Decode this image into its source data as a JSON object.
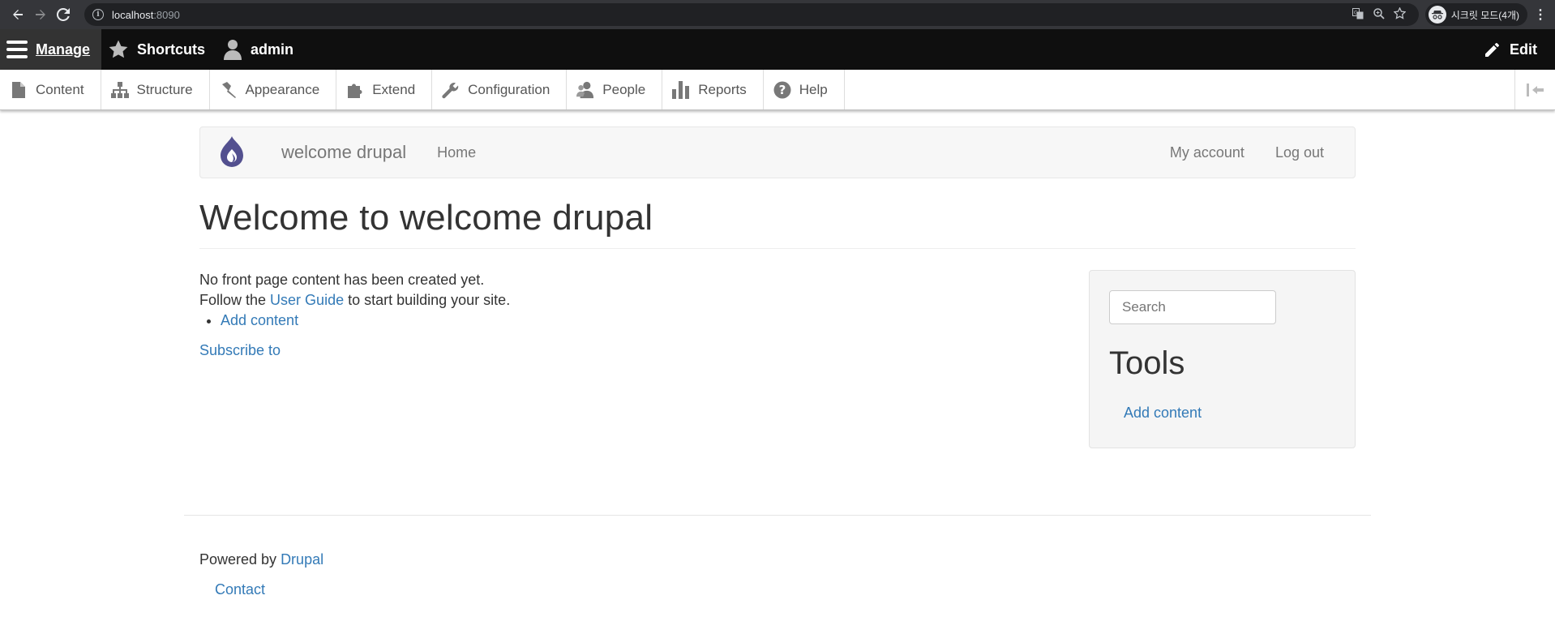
{
  "browser": {
    "url_host": "localhost",
    "url_port": ":8090",
    "profile_label": "시크릿 모드(4개)"
  },
  "toolbar": {
    "manage": "Manage",
    "shortcuts": "Shortcuts",
    "user": "admin",
    "edit": "Edit"
  },
  "tray": {
    "items": [
      "Content",
      "Structure",
      "Appearance",
      "Extend",
      "Configuration",
      "People",
      "Reports",
      "Help"
    ]
  },
  "site": {
    "name": "welcome drupal",
    "nav_home": "Home",
    "my_account": "My account",
    "log_out": "Log out"
  },
  "page": {
    "title": "Welcome to welcome drupal",
    "line1": "No front page content has been created yet.",
    "line2_pre": "Follow the ",
    "line2_link": "User Guide",
    "line2_post": " to start building your site.",
    "add_content": "Add content",
    "subscribe": "Subscribe to"
  },
  "sidebar": {
    "search_placeholder": "Search",
    "tools_title": "Tools",
    "tools_link": "Add content"
  },
  "footer": {
    "powered_by": "Powered by ",
    "drupal_link": "Drupal",
    "contact": "Contact"
  },
  "colors": {
    "toolbar_bg": "#0f0f0f",
    "manage_bg": "#333333",
    "link": "#337ab7",
    "logo": "#53508f"
  }
}
